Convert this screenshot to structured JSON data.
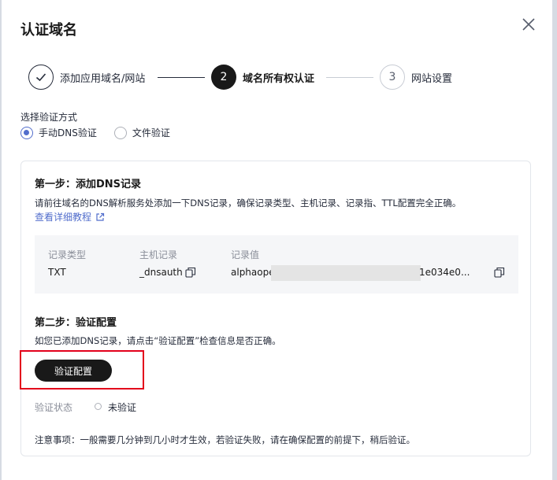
{
  "dialog": {
    "title": "认证域名"
  },
  "steps": [
    {
      "index": "",
      "label": "添加应用域名/网站",
      "state": "done"
    },
    {
      "index": "2",
      "label": "域名所有权认证",
      "state": "active"
    },
    {
      "index": "3",
      "label": "网站设置",
      "state": "todo"
    }
  ],
  "method": {
    "label": "选择验证方式",
    "options": [
      {
        "label": "手动DNS验证",
        "checked": true
      },
      {
        "label": "文件验证",
        "checked": false
      }
    ]
  },
  "step1": {
    "title": "第一步：添加DNS记录",
    "description": "请前往域名的DNS解析服务处添加一下DNS记录，确保记录类型、主机记录、记录指、TTL配置完全正确。",
    "link": "查看详细教程",
    "record": {
      "headers": [
        "记录类型",
        "主机记录",
        "记录值"
      ],
      "type": "TXT",
      "host": "_dnsauth",
      "value_start": "alphaoper",
      "value_end": "1e034e0..."
    }
  },
  "step2": {
    "title": "第二步：验证配置",
    "description": "如您已添加DNS记录，请点击“验证配置”检查信息是否正确。",
    "button": "验证配置",
    "status_label": "验证状态",
    "status_value": "未验证"
  },
  "note": "注意事项：一般需要几分钟到几小时才生效，若验证失败，请在确保配置的前提下，稍后验证。",
  "colors": {
    "accent": "#526ecc",
    "primary_button": "#191919",
    "highlight": "#e3001b"
  }
}
